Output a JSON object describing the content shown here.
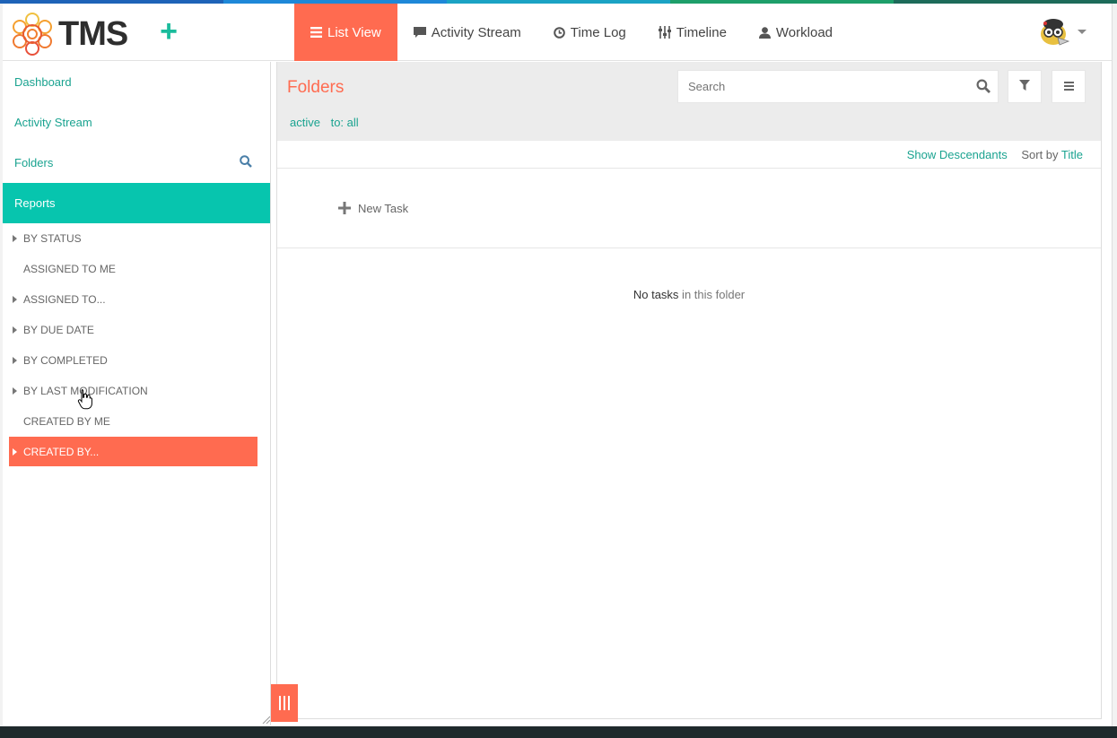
{
  "app": {
    "logo_text": "TMS",
    "add_symbol": "+"
  },
  "colors": {
    "accent": "#ff6b50",
    "teal": "#07c5ae",
    "link": "#1aa390",
    "top_stripe": [
      "#1e63b8",
      "#1e88d8",
      "#1ba3c4",
      "#1e9f6a",
      "#1d6b5a"
    ]
  },
  "nav": [
    {
      "label": "List View",
      "icon": "list-icon",
      "active": true
    },
    {
      "label": "Activity Stream",
      "icon": "comment-icon",
      "active": false
    },
    {
      "label": "Time Log",
      "icon": "clock-icon",
      "active": false
    },
    {
      "label": "Timeline",
      "icon": "sliders-icon",
      "active": false
    },
    {
      "label": "Workload",
      "icon": "user-icon",
      "active": false
    }
  ],
  "sidebar": {
    "links": [
      {
        "label": "Dashboard"
      },
      {
        "label": "Activity Stream"
      },
      {
        "label": "Folders"
      },
      {
        "label": "Reports"
      }
    ],
    "reports": [
      {
        "label": "BY STATUS",
        "expandable": true
      },
      {
        "label": "ASSIGNED TO ME",
        "expandable": false
      },
      {
        "label": "ASSIGNED TO...",
        "expandable": true
      },
      {
        "label": "BY DUE DATE",
        "expandable": true
      },
      {
        "label": "BY COMPLETED",
        "expandable": true
      },
      {
        "label": "BY LAST MODIFICATION",
        "expandable": true
      },
      {
        "label": "CREATED BY ME",
        "expandable": false
      },
      {
        "label": "CREATED BY...",
        "expandable": true,
        "selected": true
      }
    ]
  },
  "main": {
    "title": "Folders",
    "filters": [
      "active",
      "to: all"
    ],
    "search_placeholder": "Search",
    "show_descendants": "Show Descendants",
    "sort_by_label": "Sort by",
    "sort_by_value": "Title",
    "new_task_label": "New Task",
    "empty_bold": "No tasks",
    "empty_rest": " in this folder"
  }
}
